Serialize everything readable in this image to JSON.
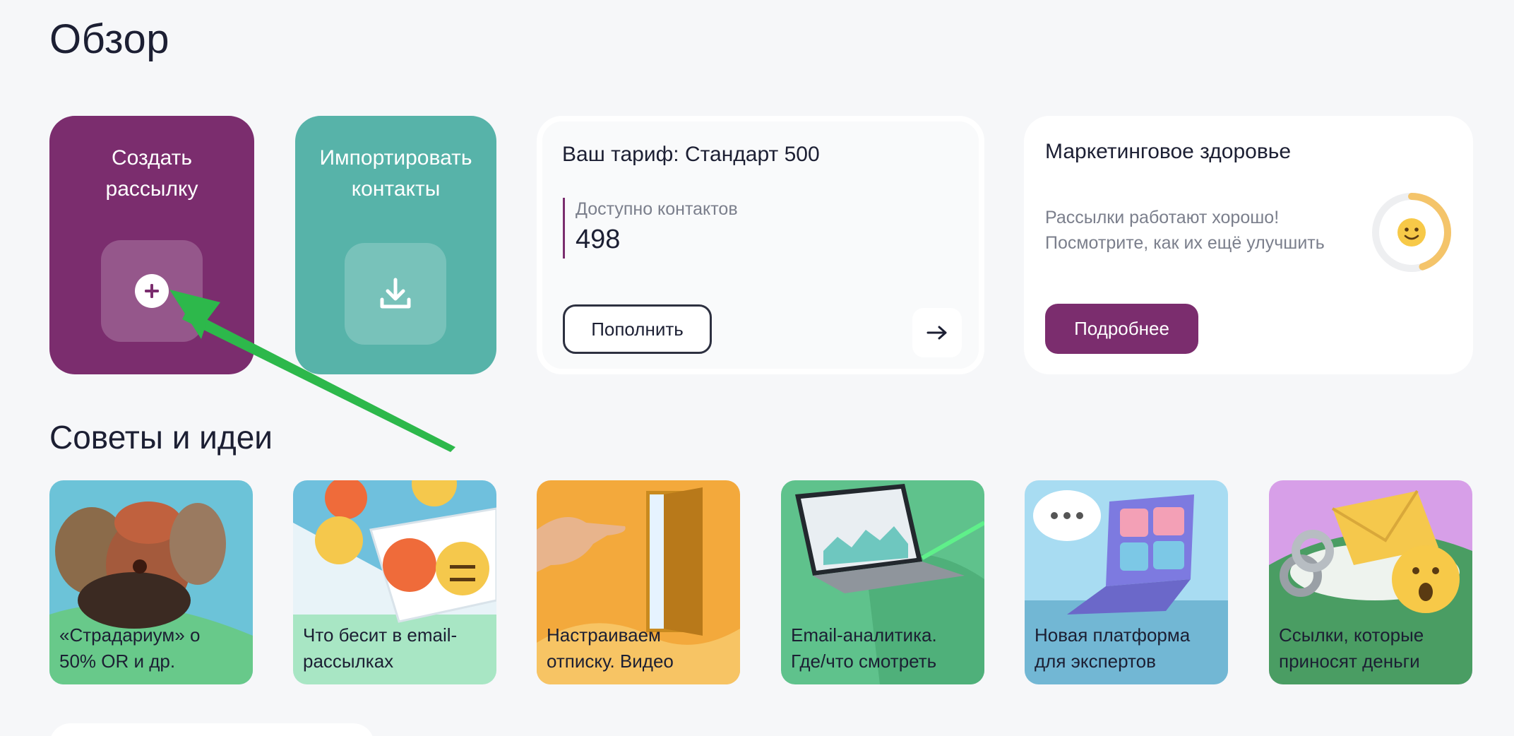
{
  "page": {
    "title": "Обзор"
  },
  "actions": {
    "create": {
      "label_line1": "Создать",
      "label_line2": "рассылку",
      "icon": "plus-icon"
    },
    "import": {
      "label_line1": "Импортировать",
      "label_line2": "контакты",
      "icon": "download-icon"
    }
  },
  "tariff": {
    "title": "Ваш тариф: Стандарт 500",
    "available_label": "Доступно контактов",
    "available_value": "498",
    "topup_label": "Пополнить",
    "arrow_icon": "arrow-right-icon"
  },
  "health": {
    "title": "Маркетинговое здоровье",
    "desc_line1": "Рассылки работают хорошо!",
    "desc_line2": "Посмотрите, как их ещё улучшить",
    "gauge_fraction": 0.45,
    "gauge_emoji": "🙂",
    "more_label": "Подробнее"
  },
  "tips": {
    "heading": "Советы и идеи",
    "items": [
      {
        "line1": "«Страдариум» о",
        "line2": "50% OR и др."
      },
      {
        "line1": "Что бесит в email-",
        "line2": "рассылках"
      },
      {
        "line1": "Настраиваем",
        "line2": "отписку. Видео"
      },
      {
        "line1": "Email-аналитика.",
        "line2": "Где/что смотреть"
      },
      {
        "line1": "Новая платформа",
        "line2": "для экспертов"
      },
      {
        "line1": "Ссылки, которые",
        "line2": "приносят деньги"
      }
    ]
  },
  "colors": {
    "brand_purple": "#7b2d6e",
    "teal": "#57b3a9",
    "annotation_green": "#2db84b"
  }
}
